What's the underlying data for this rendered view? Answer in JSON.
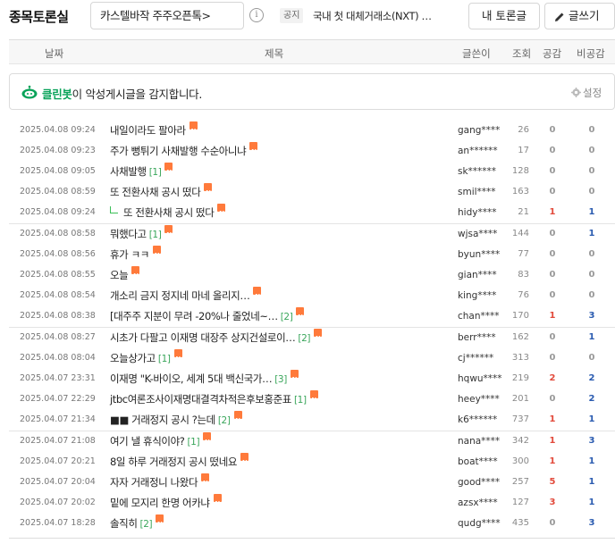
{
  "topbar": {
    "board_title": "종목토론실",
    "stock_selector": "카스텔바작 주주오픈톡>",
    "info_icon": "info-icon",
    "notice_badge": "공지",
    "notice_text": "국내 첫 대체거래소(NXT) …",
    "my_posts_label": "내 토론글",
    "write_label": "글쓰기"
  },
  "columns": {
    "date": "날짜",
    "title": "제목",
    "author": "글쓴이",
    "views": "조회",
    "likes": "공감",
    "dislikes": "비공감"
  },
  "cleanbot": {
    "name": "클린봇",
    "message": "이 악성게시글을 감지합니다.",
    "settings_label": "설정"
  },
  "colors": {
    "accent_green": "#0aa35a",
    "new_badge": "#ff7a3b",
    "like_red": "#e24a3b",
    "dislike_blue": "#2a5bb0"
  },
  "posts": [
    {
      "date": "2025.04.08 09:24",
      "title": "내일이라도 팔아라",
      "comments": "",
      "author": "gang****",
      "views": "26",
      "likes": "0",
      "dislikes": "0",
      "reply": false,
      "sep": false
    },
    {
      "date": "2025.04.08 09:23",
      "title": "주가 뻥튀기 사채발행 수순아니냐",
      "comments": "",
      "author": "an******",
      "views": "17",
      "likes": "0",
      "dislikes": "0",
      "reply": false,
      "sep": false
    },
    {
      "date": "2025.04.08 09:05",
      "title": "사채발행",
      "comments": "[1]",
      "author": "sk******",
      "views": "128",
      "likes": "0",
      "dislikes": "0",
      "reply": false,
      "sep": false
    },
    {
      "date": "2025.04.08 08:59",
      "title": "또 전환사채 공시 떴다",
      "comments": "",
      "author": "smil****",
      "views": "163",
      "likes": "0",
      "dislikes": "0",
      "reply": false,
      "sep": false
    },
    {
      "date": "2025.04.08 09:24",
      "title": "또 전환사채 공시 떴다",
      "comments": "",
      "author": "hidy****",
      "views": "21",
      "likes": "1",
      "dislikes": "1",
      "reply": true,
      "sep": true
    },
    {
      "date": "2025.04.08 08:58",
      "title": "뭐했다고",
      "comments": "[1]",
      "author": "wjsa****",
      "views": "144",
      "likes": "0",
      "dislikes": "1",
      "reply": false,
      "sep": false
    },
    {
      "date": "2025.04.08 08:56",
      "title": "휴가 ㅋㅋ",
      "comments": "",
      "author": "byun****",
      "views": "77",
      "likes": "0",
      "dislikes": "0",
      "reply": false,
      "sep": false
    },
    {
      "date": "2025.04.08 08:55",
      "title": "오늘",
      "comments": "",
      "author": "gian****",
      "views": "83",
      "likes": "0",
      "dislikes": "0",
      "reply": false,
      "sep": false
    },
    {
      "date": "2025.04.08 08:54",
      "title": "개소리 금지 정지네 마네 올리지…",
      "comments": "",
      "author": "king****",
      "views": "76",
      "likes": "0",
      "dislikes": "0",
      "reply": false,
      "sep": false
    },
    {
      "date": "2025.04.08 08:38",
      "title": "[대주주 지분이 무려 -20%나 줄었네~…",
      "comments": "[2]",
      "author": "chan****",
      "views": "170",
      "likes": "1",
      "dislikes": "3",
      "reply": false,
      "sep": true
    },
    {
      "date": "2025.04.08 08:27",
      "title": "시초가 다팔고 이재명 대장주 상지건설로이…",
      "comments": "[2]",
      "author": "berr****",
      "views": "162",
      "likes": "0",
      "dislikes": "1",
      "reply": false,
      "sep": false
    },
    {
      "date": "2025.04.08 08:04",
      "title": "오늘상가고",
      "comments": "[1]",
      "author": "cj******",
      "views": "313",
      "likes": "0",
      "dislikes": "0",
      "reply": false,
      "sep": false
    },
    {
      "date": "2025.04.07 23:31",
      "title": "이재명 \"K-바이오, 세계 5대 백신국가…",
      "comments": "[3]",
      "author": "hqwu****",
      "views": "219",
      "likes": "2",
      "dislikes": "2",
      "reply": false,
      "sep": false
    },
    {
      "date": "2025.04.07 22:29",
      "title": "jtbc여론조사이재명대결격차적은후보홍준표",
      "comments": "[1]",
      "author": "heey****",
      "views": "201",
      "likes": "0",
      "dislikes": "2",
      "reply": false,
      "sep": false
    },
    {
      "date": "2025.04.07 21:34",
      "title": "■■ 거래정지 공시 ?는데",
      "comments": "[2]",
      "author": "k6******",
      "views": "737",
      "likes": "1",
      "dislikes": "1",
      "reply": false,
      "sep": true
    },
    {
      "date": "2025.04.07 21:08",
      "title": "여기 낼 휴식이야?",
      "comments": "[1]",
      "author": "nana****",
      "views": "342",
      "likes": "1",
      "dislikes": "3",
      "reply": false,
      "sep": false
    },
    {
      "date": "2025.04.07 20:21",
      "title": "8일 하루 거래정지 공시 떴네요",
      "comments": "",
      "author": "boat****",
      "views": "300",
      "likes": "1",
      "dislikes": "1",
      "reply": false,
      "sep": false
    },
    {
      "date": "2025.04.07 20:04",
      "title": "자자 거래정니 나왔다",
      "comments": "",
      "author": "good****",
      "views": "257",
      "likes": "5",
      "dislikes": "1",
      "reply": false,
      "sep": false
    },
    {
      "date": "2025.04.07 20:02",
      "title": "밑에 모지리 한명 어카냐",
      "comments": "",
      "author": "azsx****",
      "views": "127",
      "likes": "3",
      "dislikes": "1",
      "reply": false,
      "sep": false
    },
    {
      "date": "2025.04.07 18:28",
      "title": "솔직히",
      "comments": "[2]",
      "author": "qudg****",
      "views": "435",
      "likes": "0",
      "dislikes": "3",
      "reply": false,
      "sep": false
    }
  ]
}
